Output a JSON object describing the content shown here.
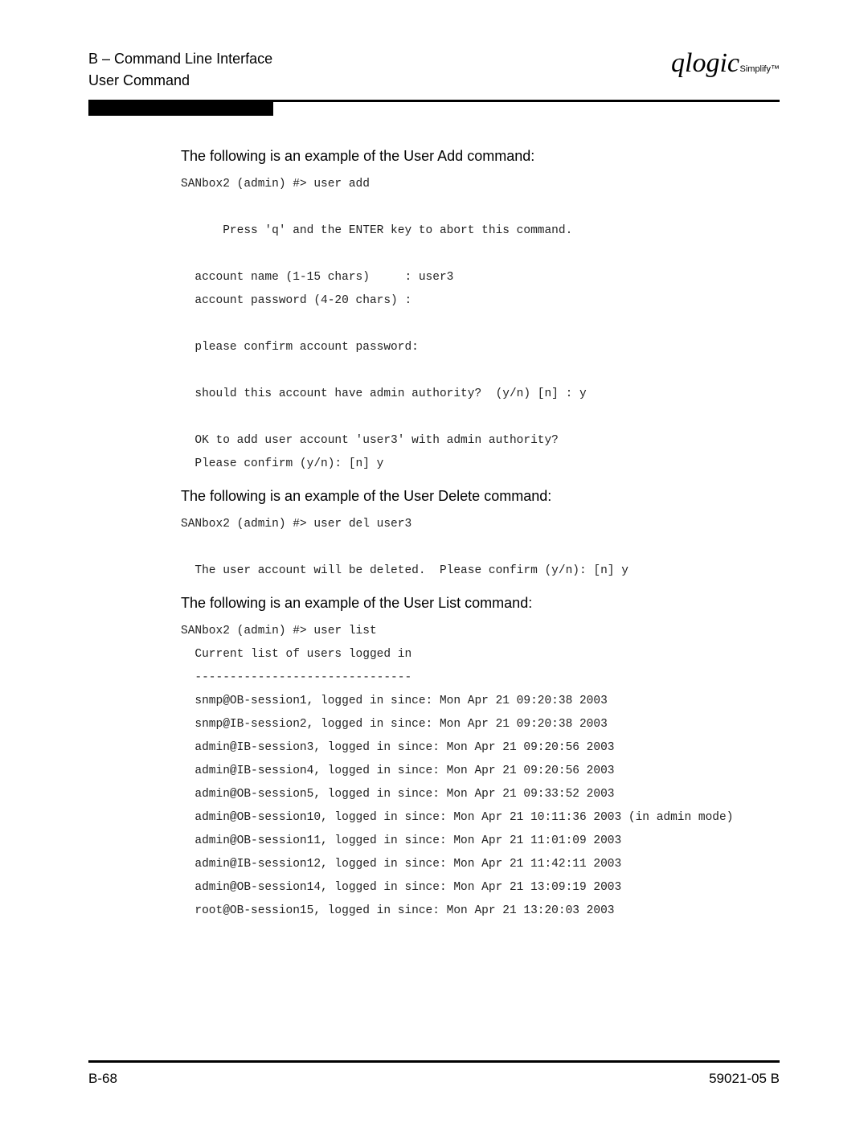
{
  "header": {
    "section": "B – Command Line Interface",
    "subsection": "User Command",
    "logo_text": "qlogic",
    "logo_sub": "Simplify™"
  },
  "body": {
    "intro_add": "The following is an example of the User Add command:",
    "code_add": "SANbox2 (admin) #> user add\n\n      Press 'q' and the ENTER key to abort this command.\n\n  account name (1-15 chars)     : user3\n  account password (4-20 chars) :\n\n  please confirm account password:\n\n  should this account have admin authority?  (y/n) [n] : y\n\n  OK to add user account 'user3' with admin authority?\n  Please confirm (y/n): [n] y",
    "intro_delete": "The following is an example of the User Delete command:",
    "code_delete": "SANbox2 (admin) #> user del user3\n\n  The user account will be deleted.  Please confirm (y/n): [n] y",
    "intro_list": "The following is an example of the User List command:",
    "code_list": "SANbox2 (admin) #> user list\n  Current list of users logged in\n  -------------------------------\n  snmp@OB-session1, logged in since: Mon Apr 21 09:20:38 2003\n  snmp@IB-session2, logged in since: Mon Apr 21 09:20:38 2003\n  admin@IB-session3, logged in since: Mon Apr 21 09:20:56 2003\n  admin@IB-session4, logged in since: Mon Apr 21 09:20:56 2003\n  admin@OB-session5, logged in since: Mon Apr 21 09:33:52 2003\n  admin@OB-session10, logged in since: Mon Apr 21 10:11:36 2003 (in admin mode)\n  admin@OB-session11, logged in since: Mon Apr 21 11:01:09 2003\n  admin@IB-session12, logged in since: Mon Apr 21 11:42:11 2003\n  admin@OB-session14, logged in since: Mon Apr 21 13:09:19 2003\n  root@OB-session15, logged in since: Mon Apr 21 13:20:03 2003"
  },
  "footer": {
    "page_num": "B-68",
    "doc_num": "59021-05  B"
  }
}
